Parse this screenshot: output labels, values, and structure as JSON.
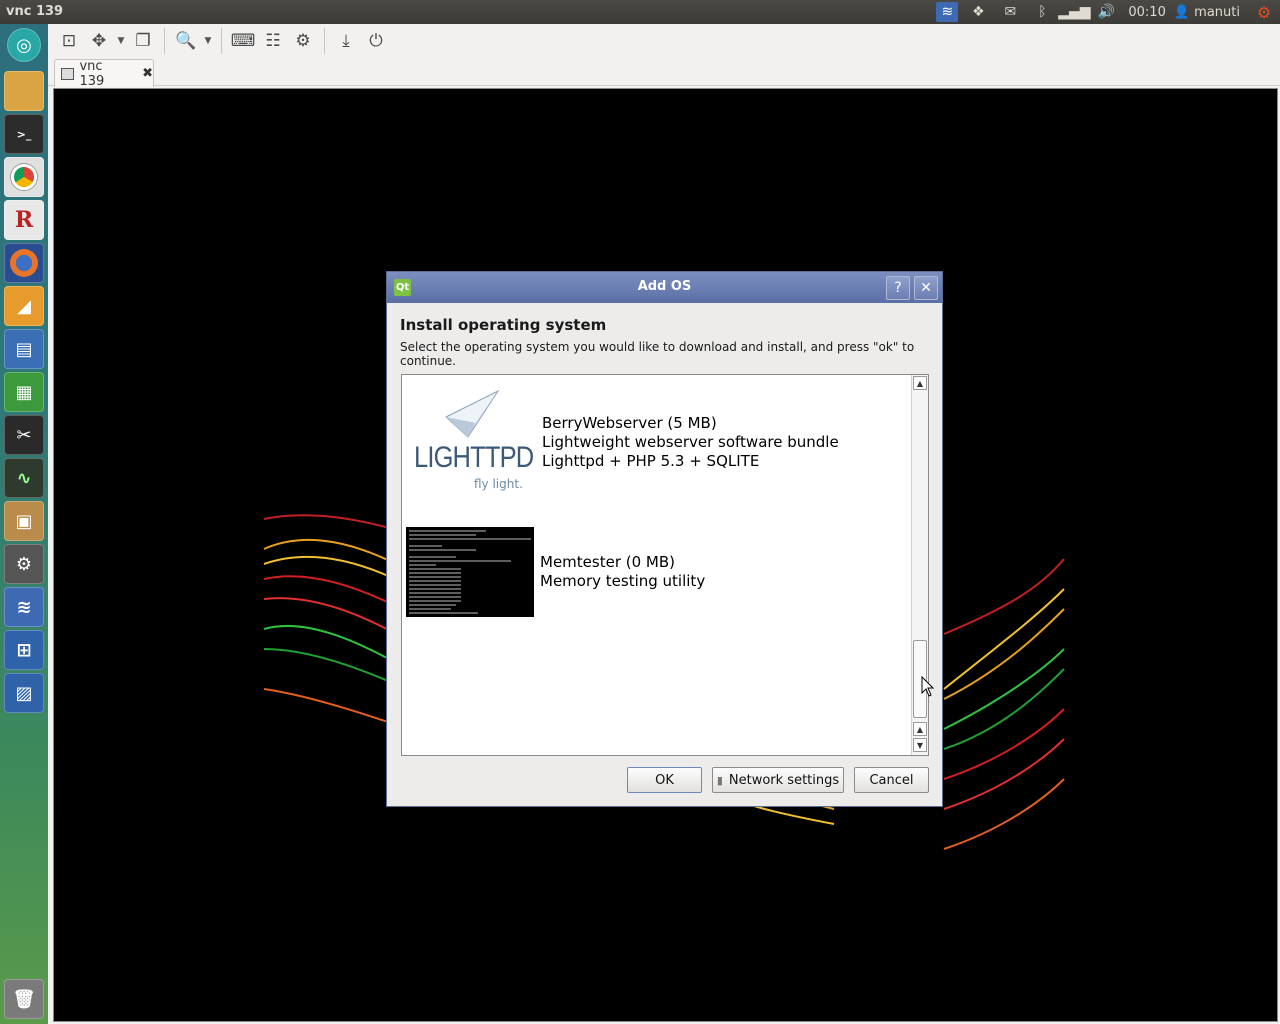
{
  "top_panel": {
    "title": "vnc 139",
    "clock": "00:10",
    "user": "manuti"
  },
  "tab": {
    "label": "vnc 139",
    "close": "✖"
  },
  "dialog": {
    "title": "Add OS",
    "help": "?",
    "close": "✕",
    "qt_badge": "Qt",
    "heading": "Install operating system",
    "description": "Select the operating system you would like to download and install, and press \"ok\" to continue.",
    "items": [
      {
        "name": "BerryWebserver (5 MB)",
        "line2": "Lightweight webserver software bundle",
        "line3": "Lighttpd + PHP 5.3 + SQLITE",
        "logo_text": "LIGHTTPD",
        "logo_tagline": "fly light."
      },
      {
        "name": "Memtester (0 MB)",
        "line2": "Memory testing utility"
      }
    ],
    "buttons": {
      "ok": "OK",
      "network": "Network settings",
      "cancel": "Cancel"
    }
  }
}
